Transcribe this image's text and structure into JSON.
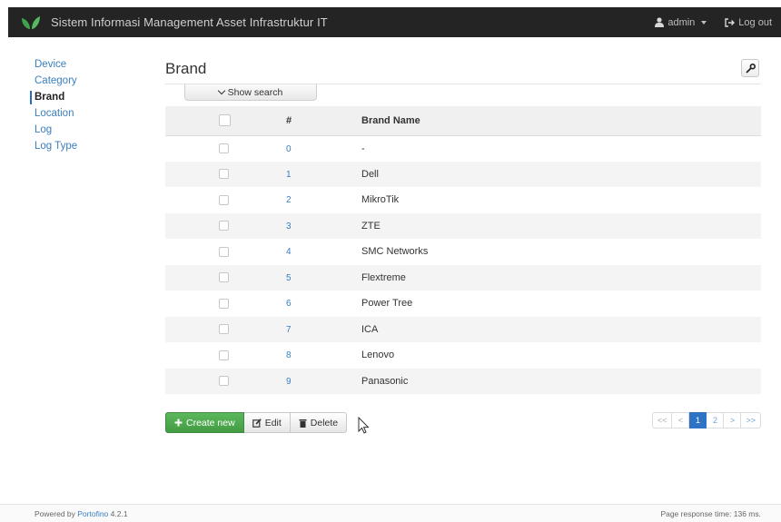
{
  "app": {
    "title": "Sistem Informasi Management Asset Infrastruktur IT"
  },
  "nav": {
    "user_label": "admin",
    "logout_label": "Log out"
  },
  "sidebar": {
    "items": [
      {
        "label": "Device"
      },
      {
        "label": "Category"
      },
      {
        "label": "Brand"
      },
      {
        "label": "Location"
      },
      {
        "label": "Log"
      },
      {
        "label": "Log Type"
      }
    ]
  },
  "page": {
    "title": "Brand",
    "show_search_label": "Show search"
  },
  "table": {
    "headers": {
      "num": "#",
      "name": "Brand Name"
    },
    "rows": [
      {
        "id": "0",
        "name": "-"
      },
      {
        "id": "1",
        "name": "Dell"
      },
      {
        "id": "2",
        "name": "MikroTik"
      },
      {
        "id": "3",
        "name": "ZTE"
      },
      {
        "id": "4",
        "name": "SMC Networks"
      },
      {
        "id": "5",
        "name": "Flextreme"
      },
      {
        "id": "6",
        "name": "Power Tree"
      },
      {
        "id": "7",
        "name": "ICA"
      },
      {
        "id": "8",
        "name": "Lenovo"
      },
      {
        "id": "9",
        "name": "Panasonic"
      }
    ]
  },
  "actions": {
    "create_label": "Create new",
    "edit_label": "Edit",
    "delete_label": "Delete"
  },
  "pagination": {
    "first": "<<",
    "prev": "<",
    "pages": [
      "1",
      "2"
    ],
    "current": "1",
    "next": ">",
    "last": ">>"
  },
  "footer": {
    "powered_prefix": "Powered by",
    "powered_link": "Portofino",
    "version": "4.2.1",
    "response_time": "Page response time: 136 ms."
  },
  "colors": {
    "navbar": "#242424",
    "link": "#3a7fc0",
    "primary_green": "#5cb85c",
    "page_active": "#2f74c4"
  },
  "icons": {
    "logo": "leaf-logo-icon",
    "user": "user-icon",
    "logout": "logout-icon",
    "tool": "wrench-icon",
    "create": "plus-icon",
    "edit": "edit-icon",
    "delete": "trash-icon"
  }
}
